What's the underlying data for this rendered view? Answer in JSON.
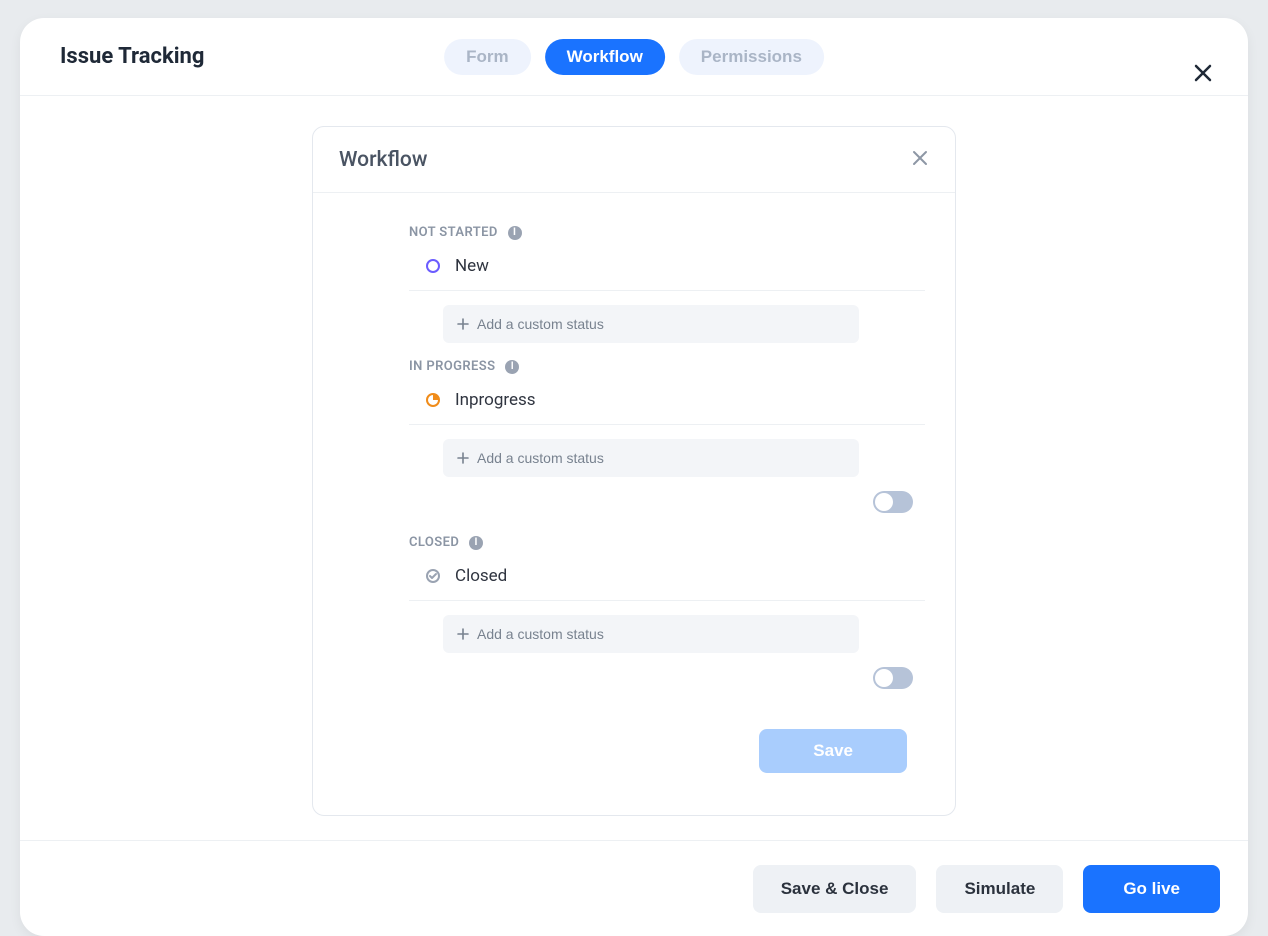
{
  "header": {
    "title": "Issue Tracking",
    "tabs": [
      {
        "label": "Form",
        "active": false
      },
      {
        "label": "Workflow",
        "active": true
      },
      {
        "label": "Permissions",
        "active": false
      }
    ]
  },
  "card": {
    "title": "Workflow",
    "add_label": "Add a custom status",
    "save_label": "Save",
    "sections": [
      {
        "heading": "NOT STARTED",
        "status_name": "New",
        "icon": "circle",
        "icon_color": "#6b5cff",
        "has_toggle": false
      },
      {
        "heading": "IN PROGRESS",
        "status_name": "Inprogress",
        "icon": "half",
        "icon_color": "#f08c1a",
        "has_toggle": true,
        "toggle": false
      },
      {
        "heading": "CLOSED",
        "status_name": "Closed",
        "icon": "check",
        "icon_color": "#9aa3b2",
        "has_toggle": true,
        "toggle": false
      }
    ]
  },
  "footer": {
    "save_close": "Save & Close",
    "simulate": "Simulate",
    "go_live": "Go live"
  }
}
